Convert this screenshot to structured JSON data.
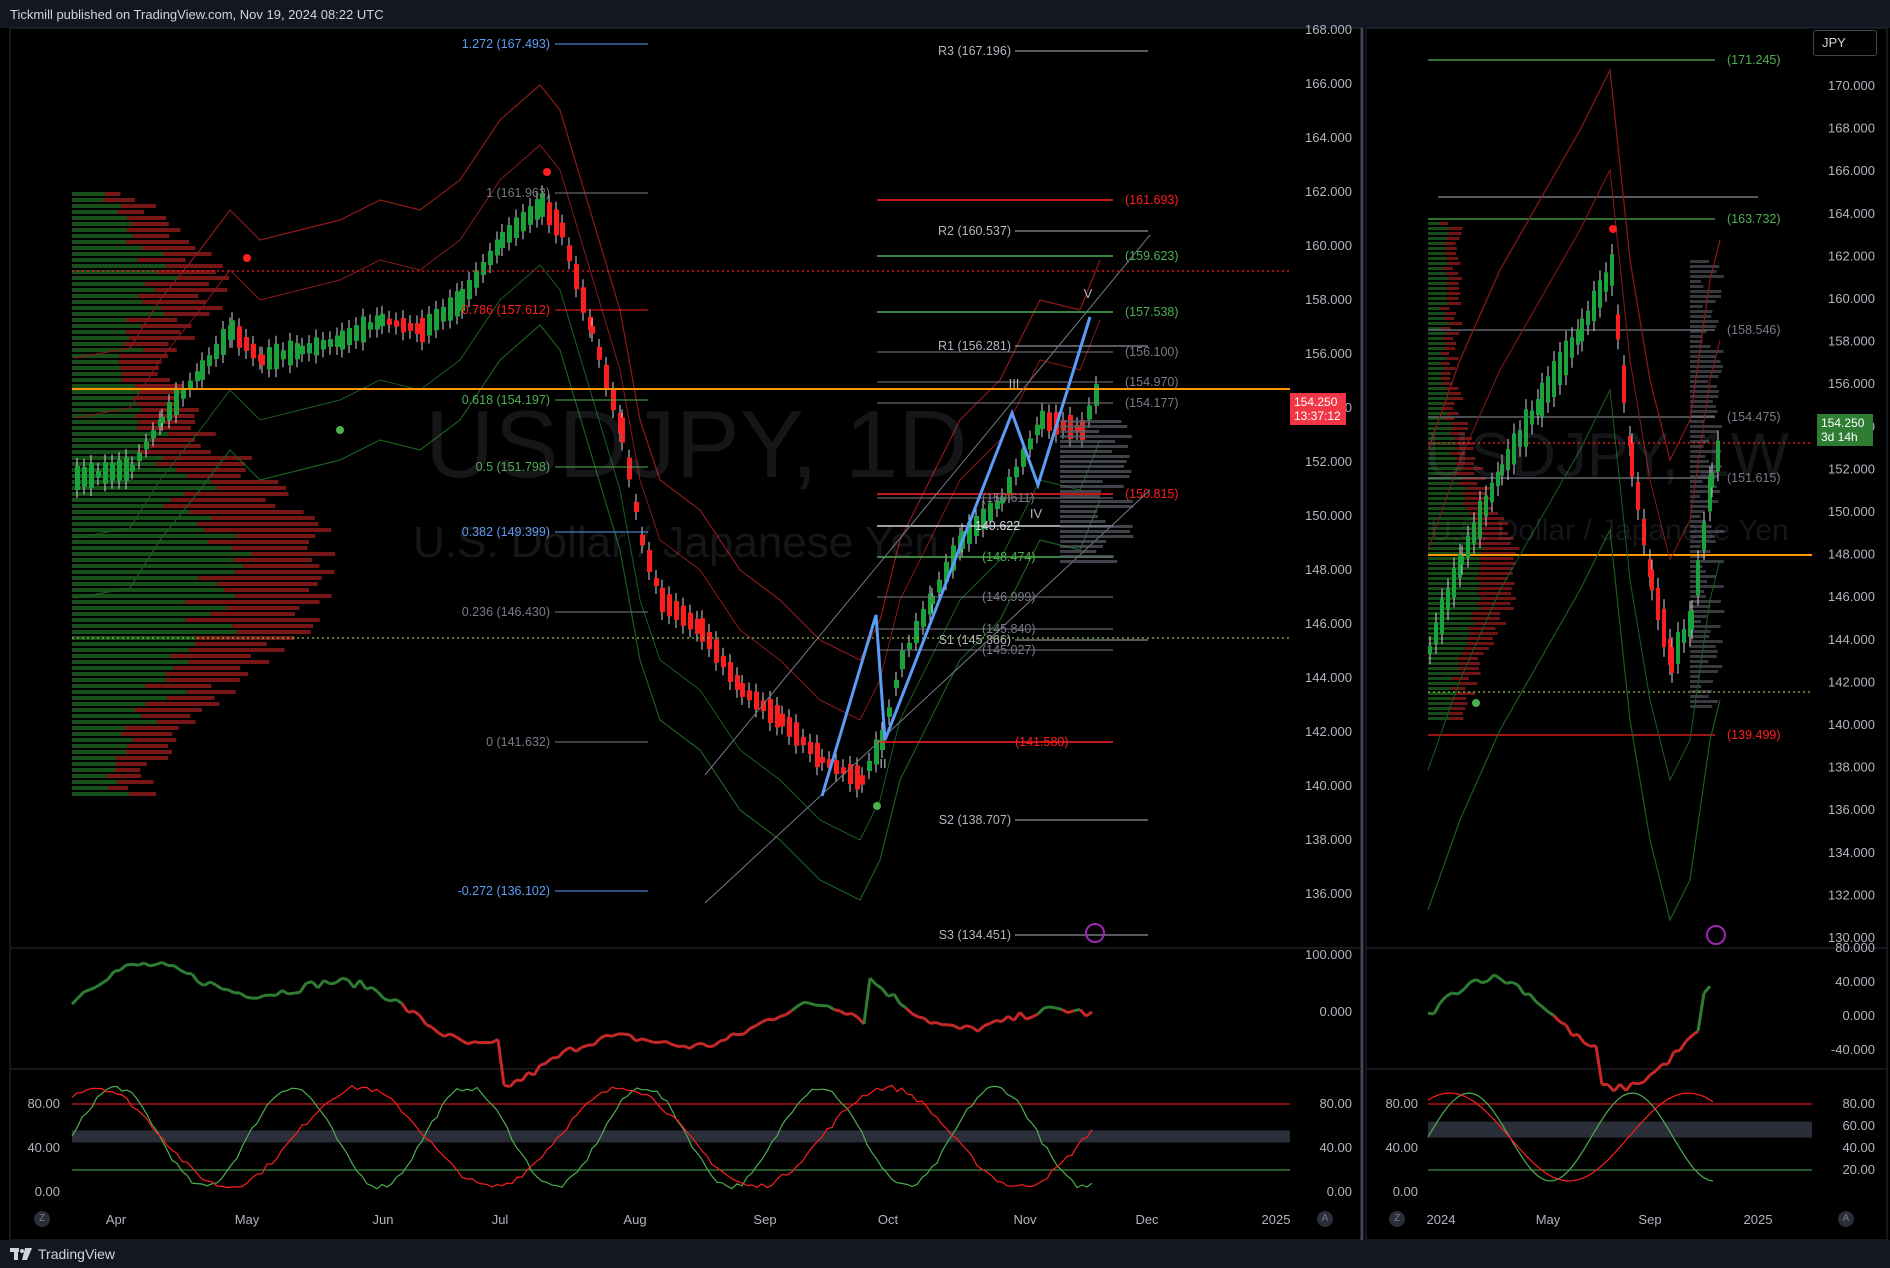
{
  "header": {
    "publisher": "Tickmill published on TradingView.com, Nov 19, 2024 08:22 UTC"
  },
  "footer": {
    "brand": "TradingView"
  },
  "main_chart": {
    "symbol_watermark": "USDJPY, 1D",
    "name_watermark": "U.S. Dollar / Japanese Yen",
    "price_axis": [
      "168.000",
      "166.000",
      "164.000",
      "162.000",
      "160.000",
      "158.000",
      "156.000",
      "154.000",
      "152.000",
      "150.000",
      "148.000",
      "146.000",
      "144.000",
      "142.000",
      "140.000",
      "138.000",
      "136.000"
    ],
    "time_axis": [
      "Apr",
      "May",
      "Jun",
      "Jul",
      "Aug",
      "Sep",
      "Oct",
      "Nov",
      "Dec",
      "2025"
    ],
    "last_price": "154.250",
    "countdown": "13:37:12",
    "fib_levels": [
      "1.272 (167.493)",
      "1 (161.963)",
      "0.786 (157.612)",
      "0.618 (154.197)",
      "0.5 (151.798)",
      "0.382 (149.399)",
      "0.236 (146.430)",
      "0 (141.632)",
      "-0.272 (136.102)"
    ],
    "pivots": [
      "R3 (167.196)",
      "R2 (160.537)",
      "R1 (156.281)",
      "S1 (145.366)",
      "S2 (138.707)",
      "S3 (134.451)"
    ],
    "proj_levels": [
      "(161.693)",
      "(159.623)",
      "(157.538)",
      "(156.100)",
      "(154.970)",
      "(154.177)",
      "(150.815)",
      "(150.611)",
      "149.622",
      "(148.474)",
      "(146.999)",
      "(145.840)",
      "(145.027)",
      "(141.580)"
    ],
    "waves": [
      "V",
      "III",
      "IV",
      "II"
    ],
    "osc1_axis": [
      "100.000",
      "0.000"
    ],
    "osc2_axis": [
      "80.00",
      "40.00",
      "0.00"
    ]
  },
  "weekly_chart": {
    "symbol_watermark": "USDJPY, 1W",
    "name_watermark": "U.S. Dollar / Japanese Yen",
    "currency_button": "JPY",
    "price_axis": [
      "170.000",
      "168.000",
      "166.000",
      "164.000",
      "162.000",
      "160.000",
      "158.000",
      "156.000",
      "154.000",
      "152.000",
      "150.000",
      "148.000",
      "146.000",
      "144.000",
      "142.000",
      "140.000",
      "138.000",
      "136.000",
      "134.000",
      "132.000",
      "130.000"
    ],
    "time_axis": [
      "2024",
      "May",
      "Sep",
      "2025"
    ],
    "last_price": "154.250",
    "countdown": "3d 14h",
    "levels": [
      "(171.245)",
      "(163.732)",
      "(158.546)",
      "(154.475)",
      "(151.615)",
      "(139.499)"
    ],
    "osc1_axis": [
      "80.000",
      "40.000",
      "0.000",
      "-40.000"
    ],
    "osc2_axis_left": [
      "80.00",
      "40.00",
      "0.00"
    ],
    "osc2_axis_right": [
      "80.00",
      "60.00",
      "40.00",
      "20.00"
    ]
  },
  "colors": {
    "up": "#089981",
    "down": "#f23645",
    "green": "#4caf50",
    "red": "#ff1e1e",
    "blue": "#5b9cf6",
    "orange": "#ff9800",
    "grid": "#1e222d"
  }
}
